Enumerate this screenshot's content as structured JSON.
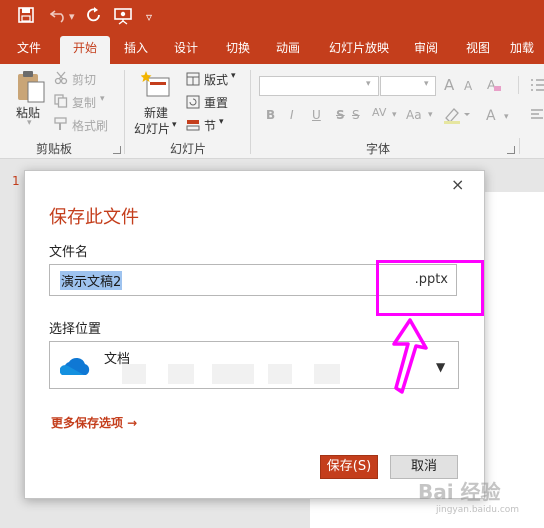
{
  "quick_access": {
    "undo_chevron": "▾",
    "more": "▿"
  },
  "tabs": [
    "文件",
    "开始",
    "插入",
    "设计",
    "切换",
    "动画",
    "幻灯片放映",
    "审阅",
    "视图",
    "加载"
  ],
  "active_tab": "开始",
  "ribbon": {
    "clipboard": {
      "paste": "粘贴",
      "cut": "剪切",
      "copy": "复制",
      "format_painter": "格式刷",
      "group_label": "剪贴板"
    },
    "slides": {
      "new_slide_line1": "新建",
      "new_slide_line2": "幻灯片",
      "layout": "版式",
      "reset": "重置",
      "section": "节",
      "group_label": "幻灯片"
    },
    "font": {
      "group_label": "字体",
      "bold": "B",
      "italic": "I",
      "underline": "U",
      "strike": "S",
      "spacing": "AV",
      "case": "Aa",
      "grow": "A",
      "shrink": "A",
      "color": "A"
    }
  },
  "slide_number": "1",
  "dialog": {
    "title": "保存此文件",
    "close": "×",
    "filename_label": "文件名",
    "filename_value": "演示文稿2",
    "extension": ".pptx",
    "location_label": "选择位置",
    "location_name": "文档",
    "more_options": "更多保存选项 →",
    "save_button": "保存(S)",
    "cancel_button": "取消"
  },
  "watermark": {
    "main": "Bai 经验",
    "sub": "jingyan.baidu.com"
  },
  "colors": {
    "accent": "#c43e1c",
    "highlight": "#ff00ff",
    "selection": "#9ec3ef"
  }
}
